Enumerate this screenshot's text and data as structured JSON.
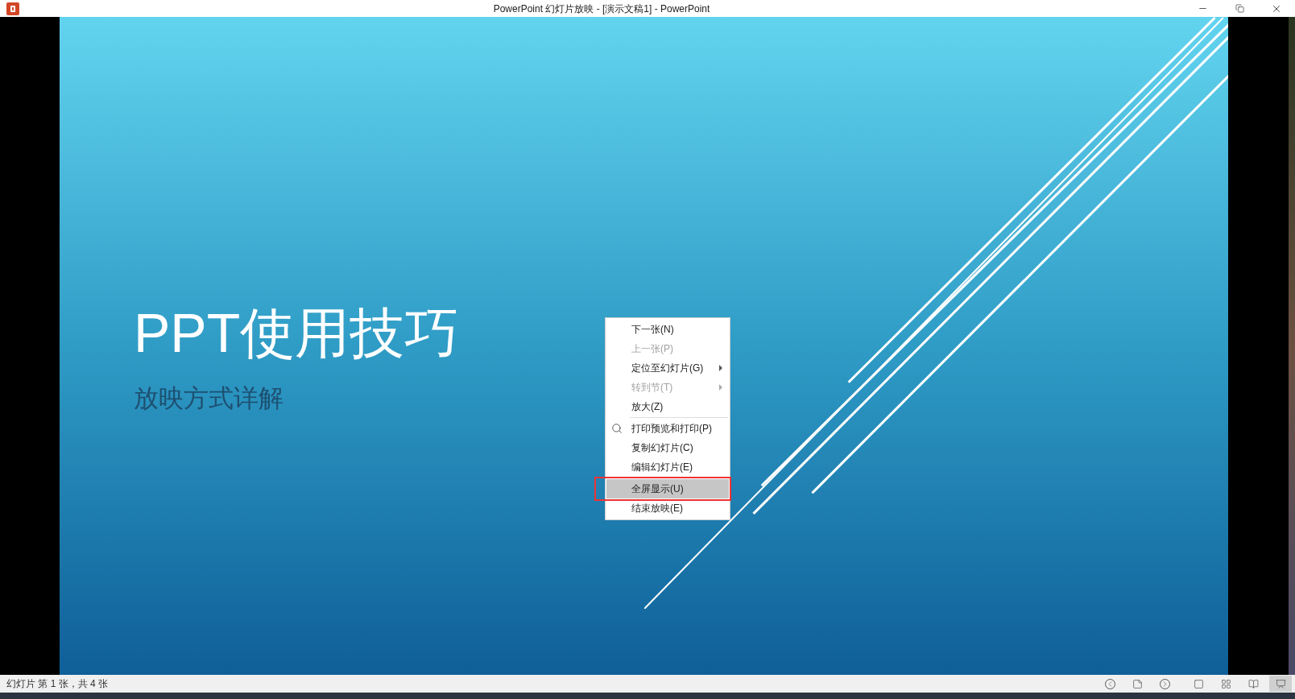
{
  "window": {
    "title": "PowerPoint 幻灯片放映 - [演示文稿1] - PowerPoint"
  },
  "slide": {
    "title": "PPT使用技巧",
    "subtitle": "放映方式详解"
  },
  "context_menu": {
    "items": [
      {
        "kind": "item",
        "label": "下一张(N)",
        "disabled": false,
        "submenu": false,
        "selected": false,
        "annotated": false
      },
      {
        "kind": "item",
        "label": "上一张(P)",
        "disabled": true,
        "submenu": false,
        "selected": false,
        "annotated": false
      },
      {
        "kind": "item",
        "label": "定位至幻灯片(G)",
        "disabled": false,
        "submenu": true,
        "selected": false,
        "annotated": false
      },
      {
        "kind": "item",
        "label": "转到节(T)",
        "disabled": true,
        "submenu": true,
        "selected": false,
        "annotated": false
      },
      {
        "kind": "item",
        "label": "放大(Z)",
        "disabled": false,
        "submenu": false,
        "selected": false,
        "annotated": false
      },
      {
        "kind": "separator"
      },
      {
        "kind": "icon_item",
        "label": "打印预览和打印(P)",
        "disabled": false,
        "submenu": false,
        "selected": false,
        "annotated": false
      },
      {
        "kind": "item",
        "label": "复制幻灯片(C)",
        "disabled": false,
        "submenu": false,
        "selected": false,
        "annotated": false
      },
      {
        "kind": "item",
        "label": "编辑幻灯片(E)",
        "disabled": false,
        "submenu": false,
        "selected": false,
        "annotated": false
      },
      {
        "kind": "separator"
      },
      {
        "kind": "item",
        "label": "全屏显示(U)",
        "disabled": false,
        "submenu": false,
        "selected": true,
        "annotated": true
      },
      {
        "kind": "item",
        "label": "结束放映(E)",
        "disabled": false,
        "submenu": false,
        "selected": false,
        "annotated": false
      }
    ]
  },
  "status_bar": {
    "text": "幻灯片 第 1 张，共 4 张",
    "views": [
      {
        "kind": "previous",
        "selected": false
      },
      {
        "kind": "slide",
        "selected": false
      },
      {
        "kind": "next",
        "selected": false
      },
      {
        "kind": "normal",
        "selected": false
      },
      {
        "kind": "sorter",
        "selected": false
      },
      {
        "kind": "reading",
        "selected": false
      },
      {
        "kind": "show",
        "selected": true
      }
    ]
  }
}
